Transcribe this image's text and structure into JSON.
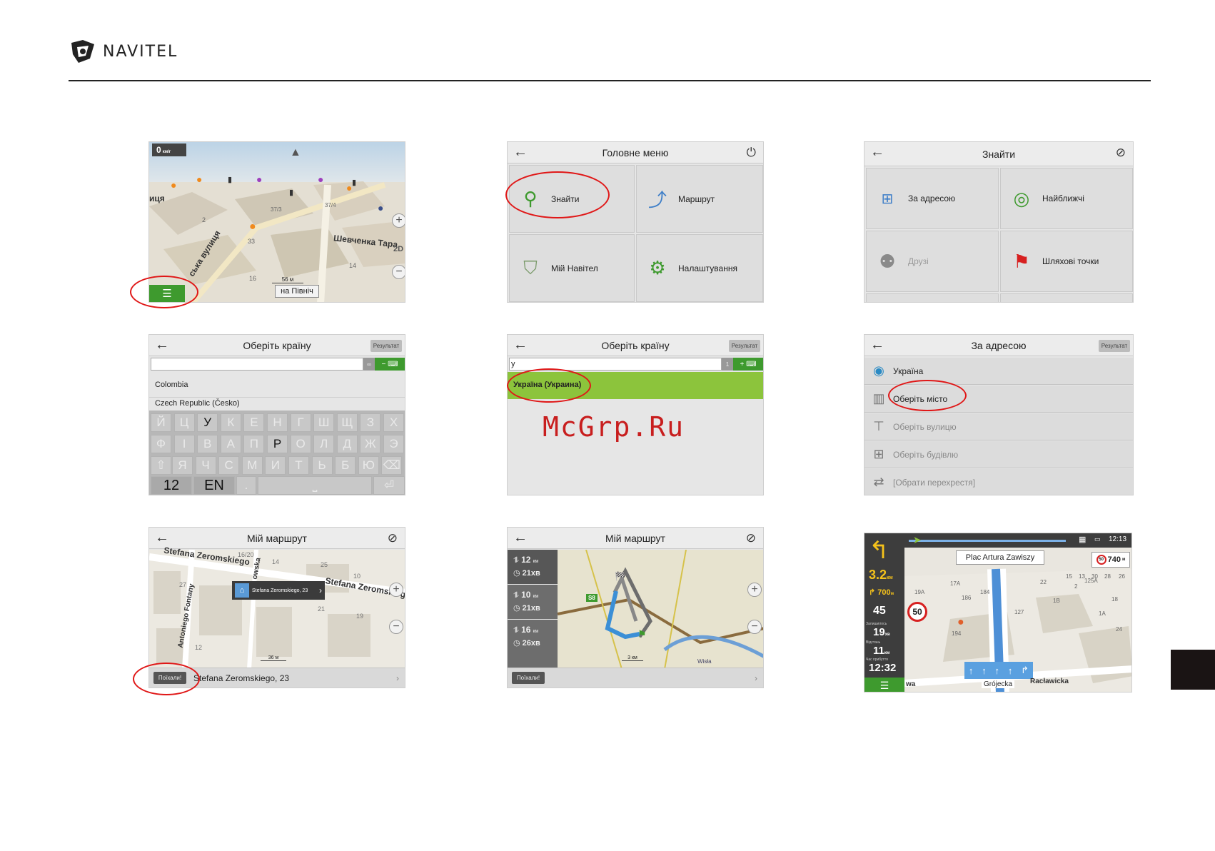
{
  "brand": {
    "name": "NAVITEL"
  },
  "watermark": "McGrp.Ru",
  "shot1": {
    "speed": "0",
    "speed_unit": "км/г",
    "streets": [
      "иця",
      "Шевченка Тара",
      "ська вулиця"
    ],
    "numbers": [
      "33",
      "16",
      "14",
      "37/3",
      "2",
      "37/4"
    ],
    "mode_2d": "2D",
    "scale": "56 м",
    "north_label": "на Північ"
  },
  "shot2": {
    "title": "Головне меню",
    "items": [
      "Знайти",
      "Маршрут",
      "Мій Навітел",
      "Налаштування"
    ]
  },
  "shot3": {
    "title": "Знайти",
    "items": [
      "За адресою",
      "Найближчі",
      "Друзі",
      "Шляхові точки"
    ]
  },
  "shot4": {
    "title": "Оберіть країну",
    "result_label": "Результат",
    "count": "∞",
    "list": [
      "Colombia",
      "Czech Republic (Česko)"
    ],
    "kb_row1": [
      "Й",
      "Ц",
      "У",
      "К",
      "Е",
      "Н",
      "Г",
      "Ш",
      "Щ",
      "З",
      "Х"
    ],
    "kb_row2": [
      "Ф",
      "І",
      "В",
      "А",
      "П",
      "Р",
      "О",
      "Л",
      "Д",
      "Ж",
      "Э"
    ],
    "kb_row3": [
      "Я",
      "Ч",
      "С",
      "М",
      "И",
      "Т",
      "Ь",
      "Б",
      "Ю"
    ],
    "kb_num": "12",
    "kb_lang": "EN",
    "kb_dot": "."
  },
  "shot5": {
    "title": "Оберіть країну",
    "result_label": "Результат",
    "input_value": "у",
    "count": "1",
    "result": "Україна (Украина)"
  },
  "shot6": {
    "title": "За адресою",
    "result_label": "Результат",
    "rows": [
      "Україна",
      "Оберіть місто",
      "Оберіть вулицю",
      "Оберіть будівлю",
      "[Обрати перехрестя]"
    ]
  },
  "shot7": {
    "title": "Мій маршрут",
    "streets": [
      "Stefana Zeromskiego",
      "Stefana Zeromskieg",
      "Antoniego Fontany",
      "owska"
    ],
    "numbers": [
      "16/20",
      "14",
      "25",
      "10",
      "27",
      "21",
      "19",
      "12"
    ],
    "popup": "Stefana Zeromskiego, 23",
    "scale": "36 м",
    "go": "Поїхали!",
    "address": "Stefana Zeromskiego, 23"
  },
  "shot8": {
    "title": "Мій маршрут",
    "routes": [
      {
        "dist": "12",
        "unit": "км",
        "time": "21хв"
      },
      {
        "dist": "10",
        "unit": "км",
        "time": "21хв"
      },
      {
        "dist": "16",
        "unit": "км",
        "time": "26хв"
      }
    ],
    "road_sign": "S8",
    "scale": "3 км",
    "river": "Wisła",
    "go": "Поїхали!"
  },
  "shot9": {
    "time": "12:13",
    "next_street": "Plac Artura Zawiszy",
    "turn_dist": "3.2",
    "turn_unit": "км",
    "next_turn": "700",
    "next_turn_unit": "м",
    "speed": "45",
    "speed_limit": "50",
    "camera_limit": "50",
    "camera_dist": "740",
    "camera_unit": "м",
    "remain_label": "Залишилось",
    "remain": "19",
    "remain_unit": "хв",
    "dist_label": "Відстань",
    "dist": "11",
    "dist_unit": "км",
    "arrival_label": "Час прибуття",
    "arrival": "12:32",
    "bottom_left": "wa",
    "bottom_street": "Grójecka",
    "bottom_right": "Racławicka",
    "numbers": [
      "17A",
      "19A",
      "186",
      "184",
      "127",
      "194",
      "1B",
      "1A",
      "125A",
      "15",
      "13",
      "30",
      "28",
      "26",
      "24",
      "22",
      "2",
      "18"
    ]
  },
  "colors": {
    "accent_green": "#8cc43c",
    "ring": "#e01717",
    "nav_dark": "#3d3d3d"
  }
}
